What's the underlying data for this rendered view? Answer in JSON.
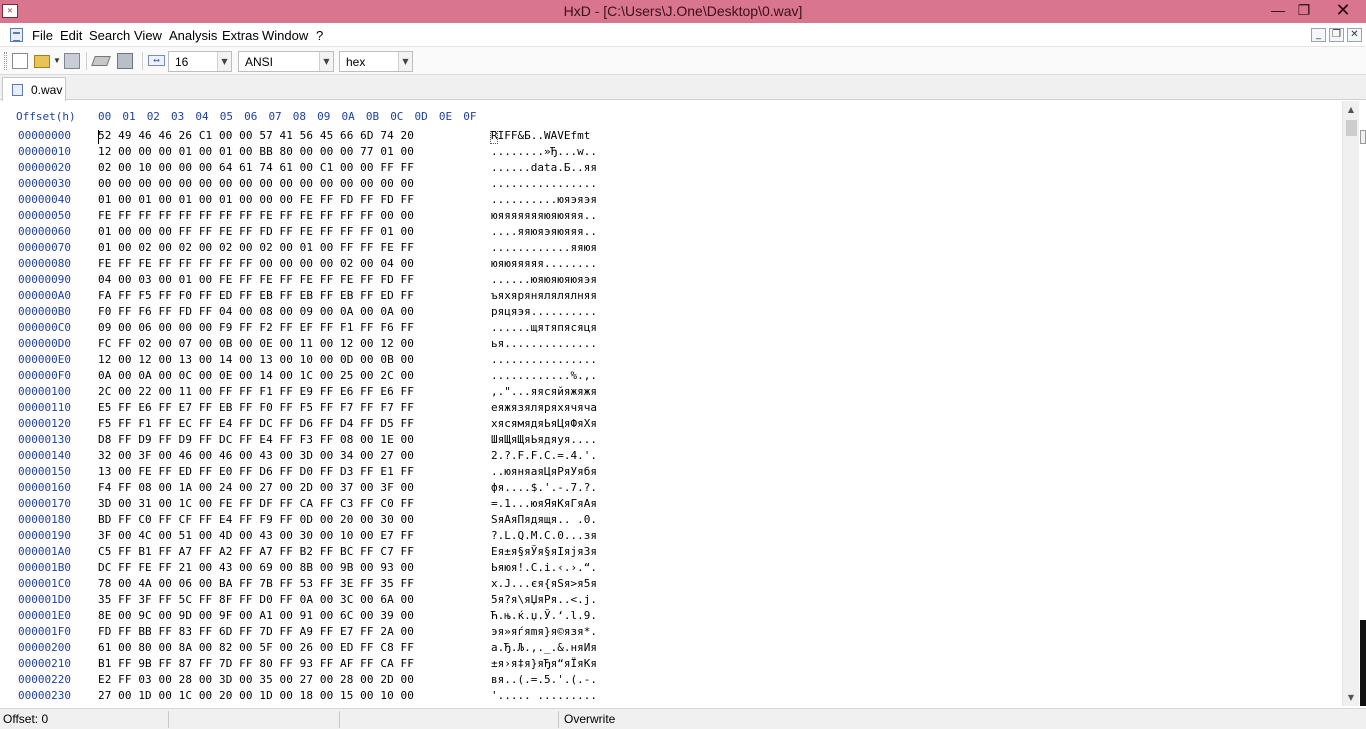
{
  "window": {
    "title": "HxD - [C:\\Users\\J.One\\Desktop\\0.wav]",
    "app_icon": "hxd-icon",
    "controls": [
      "minimize-icon",
      "restore-icon",
      "close-icon"
    ],
    "accent_color": "#d9768d"
  },
  "menu": {
    "items": [
      "File",
      "Edit",
      "Search",
      "View",
      "Analysis",
      "Extras",
      "Window",
      "?"
    ]
  },
  "toolbar": {
    "icons": [
      "new-file-icon",
      "open-folder-icon",
      "save-icon",
      "cut-icon",
      "save-all-icon",
      "bytes-per-row-icon"
    ],
    "bytes_per_row": "16",
    "charset": "ANSI",
    "offset_base": "hex"
  },
  "tab": {
    "label": "0.wav"
  },
  "hex": {
    "offset_header": "Offset(h)",
    "columns": [
      "00",
      "01",
      "02",
      "03",
      "04",
      "05",
      "06",
      "07",
      "08",
      "09",
      "0A",
      "0B",
      "0C",
      "0D",
      "0E",
      "0F"
    ],
    "rows": [
      {
        "offset": "00000000",
        "bytes": "52 49 46 46 26 C1 00 00 57 41 56 45 66 6D 74 20",
        "text": "RIFF&Б..WAVEfmt "
      },
      {
        "offset": "00000010",
        "bytes": "12 00 00 00 01 00 01 00 BB 80 00 00 00 77 01 00",
        "text": "........»Ђ...w.."
      },
      {
        "offset": "00000020",
        "bytes": "02 00 10 00 00 00 64 61 74 61 00 C1 00 00 FF FF",
        "text": "......data.Б..яя"
      },
      {
        "offset": "00000030",
        "bytes": "00 00 00 00 00 00 00 00 00 00 00 00 00 00 00 00",
        "text": "................"
      },
      {
        "offset": "00000040",
        "bytes": "01 00 01 00 01 00 01 00 00 00 FE FF FD FF FD FF",
        "text": "..........юяэяэя"
      },
      {
        "offset": "00000050",
        "bytes": "FE FF FF FF FF FF FF FF FE FF FE FF FF FF 00 00",
        "text": "юяяяяяяяюяюяяя.."
      },
      {
        "offset": "00000060",
        "bytes": "01 00 00 00 FF FF FE FF FD FF FE FF FF FF 01 00",
        "text": "....яяюяэяюяяя.."
      },
      {
        "offset": "00000070",
        "bytes": "01 00 02 00 02 00 02 00 02 00 01 00 FF FF FE FF",
        "text": "............яяюя"
      },
      {
        "offset": "00000080",
        "bytes": "FE FF FE FF FF FF FF FF 00 00 00 00 02 00 04 00",
        "text": "юяюяяяяя........"
      },
      {
        "offset": "00000090",
        "bytes": "04 00 03 00 01 00 FE FF FE FF FE FF FE FF FD FF",
        "text": "......юяюяюяюяэя"
      },
      {
        "offset": "000000A0",
        "bytes": "FA FF F5 FF F0 FF ED FF EB FF EB FF EB FF ED FF",
        "text": "ъяхярянялялялняя"
      },
      {
        "offset": "000000B0",
        "bytes": "F0 FF F6 FF FD FF 04 00 08 00 09 00 0A 00 0A 00",
        "text": "ряцяэя.........."
      },
      {
        "offset": "000000C0",
        "bytes": "09 00 06 00 00 00 F9 FF F2 FF EF FF F1 FF F6 FF",
        "text": "......щятяпясяця"
      },
      {
        "offset": "000000D0",
        "bytes": "FC FF 02 00 07 00 0B 00 0E 00 11 00 12 00 12 00",
        "text": "ья.............."
      },
      {
        "offset": "000000E0",
        "bytes": "12 00 12 00 13 00 14 00 13 00 10 00 0D 00 0B 00",
        "text": "................"
      },
      {
        "offset": "000000F0",
        "bytes": "0A 00 0A 00 0C 00 0E 00 14 00 1C 00 25 00 2C 00",
        "text": "............%.,."
      },
      {
        "offset": "00000100",
        "bytes": "2C 00 22 00 11 00 FF FF F1 FF E9 FF E6 FF E6 FF",
        "text": ",.\"...яясяйяжяжя"
      },
      {
        "offset": "00000110",
        "bytes": "E5 FF E6 FF E7 FF EB FF F0 FF F5 FF F7 FF F7 FF",
        "text": "еяжязяляряхячяча"
      },
      {
        "offset": "00000120",
        "bytes": "F5 FF F1 FF EC FF E4 FF DC FF D6 FF D4 FF D5 FF",
        "text": "хясямядяЬяЦяФяХя"
      },
      {
        "offset": "00000130",
        "bytes": "D8 FF D9 FF D9 FF DC FF E4 FF F3 FF 08 00 1E 00",
        "text": "ШяЩяЩяЬядяуя...."
      },
      {
        "offset": "00000140",
        "bytes": "32 00 3F 00 46 00 46 00 43 00 3D 00 34 00 27 00",
        "text": "2.?.F.F.C.=.4.'."
      },
      {
        "offset": "00000150",
        "bytes": "13 00 FE FF ED FF E0 FF D6 FF D0 FF D3 FF E1 FF",
        "text": "..юяняаяЦяРяУябя"
      },
      {
        "offset": "00000160",
        "bytes": "F4 FF 08 00 1A 00 24 00 27 00 2D 00 37 00 3F 00",
        "text": "фя....$.'.-.7.?."
      },
      {
        "offset": "00000170",
        "bytes": "3D 00 31 00 1C 00 FE FF DF FF CA FF C3 FF C0 FF",
        "text": "=.1...юяЯяКяГяАя"
      },
      {
        "offset": "00000180",
        "bytes": "BD FF C0 FF CF FF E4 FF F9 FF 0D 00 20 00 30 00",
        "text": "SяАяПядящя.. .0."
      },
      {
        "offset": "00000190",
        "bytes": "3F 00 4C 00 51 00 4D 00 43 00 30 00 10 00 E7 FF",
        "text": "?.L.Q.M.C.0...зя"
      },
      {
        "offset": "000001A0",
        "bytes": "C5 FF B1 FF A7 FF A2 FF A7 FF B2 FF BC FF C7 FF",
        "text": "Ея±я§яЎя§яІяјяЗя"
      },
      {
        "offset": "000001B0",
        "bytes": "DC FF FE FF 21 00 43 00 69 00 8B 00 9B 00 93 00",
        "text": "Ьяюя!.C.i.‹.›.“."
      },
      {
        "offset": "000001C0",
        "bytes": "78 00 4A 00 06 00 BA FF 7B FF 53 FF 3E FF 35 FF",
        "text": "x.J...єя{яSя>я5я"
      },
      {
        "offset": "000001D0",
        "bytes": "35 FF 3F FF 5C FF 8F FF D0 FF 0A 00 3C 00 6A 00",
        "text": "5я?я\\яЏяРя..<.j."
      },
      {
        "offset": "000001E0",
        "bytes": "8E 00 9C 00 9D 00 9F 00 A1 00 91 00 6C 00 39 00",
        "text": "Ћ.њ.ќ.џ.Ў.‘.l.9."
      },
      {
        "offset": "000001F0",
        "bytes": "FD FF BB FF 83 FF 6D FF 7D FF A9 FF E7 FF 2A 00",
        "text": "эя»яѓяmя}я©язя*."
      },
      {
        "offset": "00000200",
        "bytes": "61 00 80 00 8A 00 82 00 5F 00 26 00 ED FF C8 FF",
        "text": "a.Ђ.Љ.‚._.&.няИя"
      },
      {
        "offset": "00000210",
        "bytes": "B1 FF 9B FF 87 FF 7D FF 80 FF 93 FF AF FF CA FF",
        "text": "±я›я‡я}яЂя“яЇяКя"
      },
      {
        "offset": "00000220",
        "bytes": "E2 FF 03 00 28 00 3D 00 35 00 27 00 28 00 2D 00",
        "text": "вя..(.=.5.'.(.-."
      },
      {
        "offset": "00000230",
        "bytes": "27 00 1D 00 1C 00 20 00 1D 00 18 00 15 00 10 00",
        "text": "'..... ........."
      }
    ]
  },
  "status": {
    "offset": "Offset: 0",
    "mode": "Overwrite"
  }
}
